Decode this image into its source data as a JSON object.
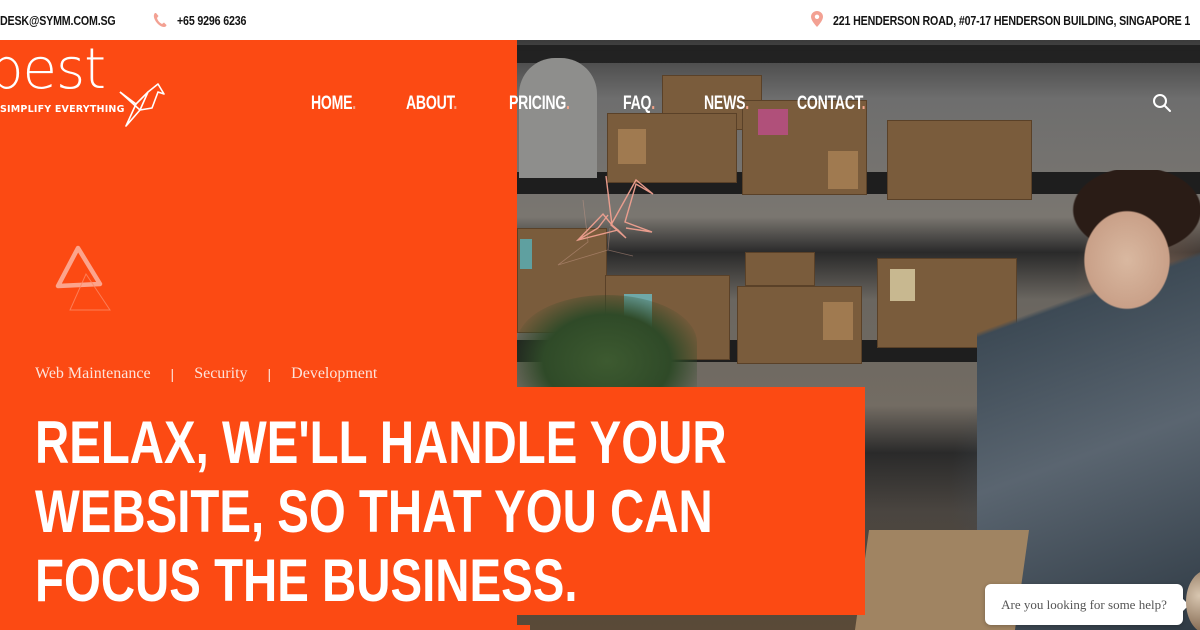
{
  "topbar": {
    "email": "DESK@SYMM.COM.SG",
    "phone_icon": "phone-icon",
    "phone": "+65 9296 6236",
    "address_icon": "map-pin-icon",
    "address": "221 HENDERSON ROAD, #07-17 HENDERSON BUILDING, SINGAPORE 1"
  },
  "logo": {
    "wordmark": "best",
    "tagline": "SIMPLIFY EVERYTHING",
    "icon": "origami-crane-icon"
  },
  "nav": {
    "items": [
      {
        "label": "HOME",
        "dot": "."
      },
      {
        "label": "ABOUT",
        "dot": "."
      },
      {
        "label": "PRICING",
        "dot": "."
      },
      {
        "label": "FAQ",
        "dot": "."
      },
      {
        "label": "NEWS",
        "dot": "."
      },
      {
        "label": "CONTACT",
        "dot": "."
      }
    ],
    "search_icon": "search-icon"
  },
  "hero": {
    "services": [
      "Web Maintenance",
      "Security",
      "Development"
    ],
    "separator": "|",
    "headline_lines": [
      "RELAX, WE'LL HANDLE YOUR",
      "WEBSITE, SO THAT YOU CAN",
      "FOCUS THE BUSINESS."
    ]
  },
  "chat": {
    "prompt": "Are you looking for some help?"
  },
  "colors": {
    "brand_orange": "#fc4a13",
    "accent_pink": "#f4a48a",
    "text_dark": "#141414"
  }
}
